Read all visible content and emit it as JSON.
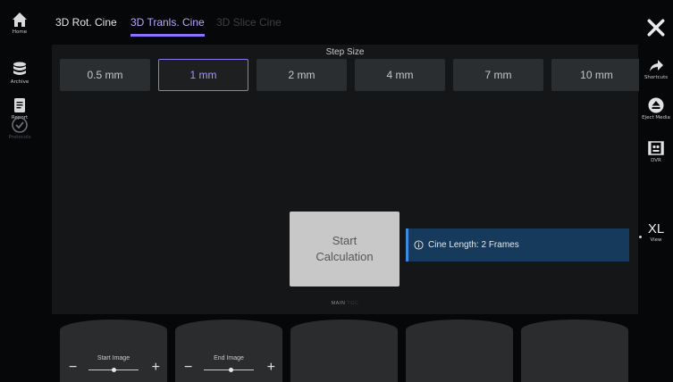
{
  "left_nav": [
    {
      "label": "Home",
      "icon": "home-icon"
    },
    {
      "label": "Archive",
      "icon": "archive-icon"
    },
    {
      "label": "Report",
      "icon": "report-icon"
    },
    {
      "label": "Protocols",
      "icon": "protocols-icon"
    }
  ],
  "right_nav": {
    "close": {
      "icon": "close-icon"
    },
    "shortcuts": {
      "label": "Shortcuts",
      "icon": "shortcut-arrow-icon"
    },
    "eject": {
      "label": "Eject Media",
      "icon": "eject-icon"
    },
    "dvr": {
      "label": "DVR",
      "icon": "dvr-icon"
    },
    "view": {
      "label": "View",
      "value": "XL"
    }
  },
  "tabs": [
    {
      "label": "3D Rot. Cine",
      "state": "normal"
    },
    {
      "label": "3D Tranls. Cine",
      "state": "active"
    },
    {
      "label": "3D Slice Cine",
      "state": "disabled"
    }
  ],
  "step_size": {
    "label": "Step Size",
    "options": [
      "0.5 mm",
      "1 mm",
      "2 mm",
      "4 mm",
      "7 mm",
      "10 mm"
    ],
    "selected": "1 mm"
  },
  "start_button": {
    "line1": "Start",
    "line2": "Calculation"
  },
  "info": {
    "text": "Cine Length: 2 Frames"
  },
  "mode": {
    "active": "MAIN",
    "inactive": "TGC"
  },
  "knobs": [
    {
      "label": "Start Image",
      "minus": "−",
      "plus": "+",
      "level": 0.5
    },
    {
      "label": "End Image",
      "minus": "−",
      "plus": "+",
      "level": 0.55
    },
    {
      "label": ""
    },
    {
      "label": ""
    },
    {
      "label": ""
    }
  ],
  "colors": {
    "accent": "#8e72ff",
    "info_bar": "#153a5c",
    "info_edge": "#3d8ae0"
  }
}
